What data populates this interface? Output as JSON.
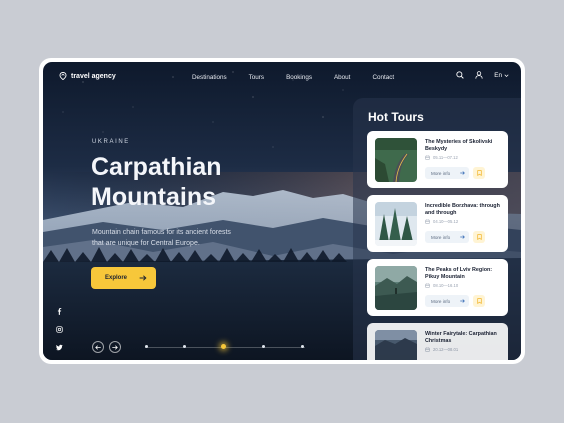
{
  "nav": {
    "logo": "travel agency",
    "menu": [
      "Destinations",
      "Tours",
      "Bookings",
      "About",
      "Contact"
    ],
    "lang": "En"
  },
  "hero": {
    "eyebrow": "UKRAINE",
    "title_line1": "Carpathian",
    "title_line2": "Mountains",
    "description": "Mountain chain famous for its ancient forests that are unique for Central Europe.",
    "cta": "Explore"
  },
  "slider": {
    "dots": 5,
    "active": 2
  },
  "social": [
    "facebook-icon",
    "instagram-icon",
    "twitter-icon"
  ],
  "hot_tours": {
    "title": "Hot Tours",
    "more_label": "More info",
    "items": [
      {
        "title": "The Mysteries of Skolivski Beskydy",
        "date": "05.11—07.12"
      },
      {
        "title": "Incredible Borzhava: through and through",
        "date": "04.10—05.12"
      },
      {
        "title": "The Peaks of Lviv Region: Pikuy Mountain",
        "date": "08.10—16.10"
      },
      {
        "title": "Winter Fairytale: Carpathian Christmas",
        "date": "20.12—08.01"
      }
    ]
  },
  "colors": {
    "accent": "#f7c73a",
    "panel": "#28344c",
    "sky_top": "#0f1a2e"
  }
}
